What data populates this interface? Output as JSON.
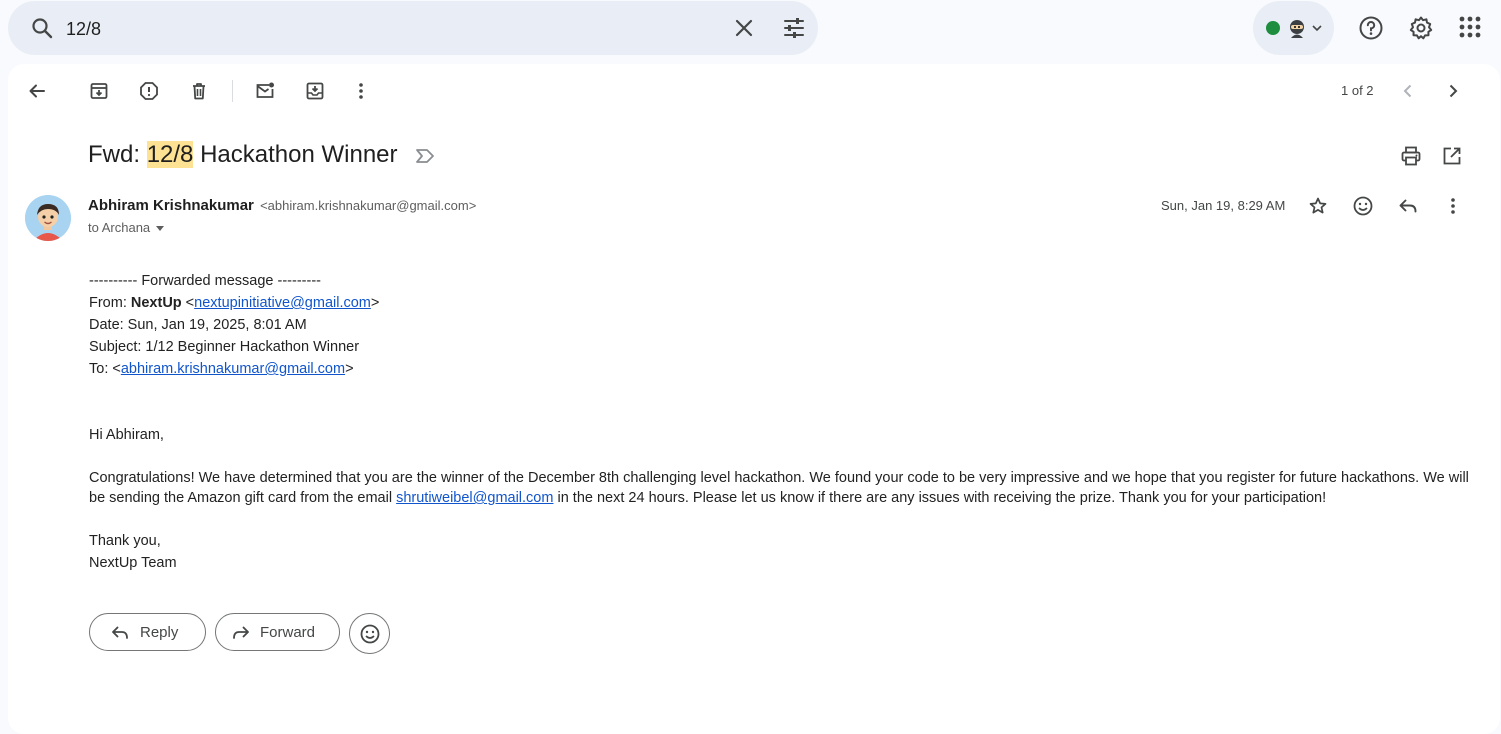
{
  "search": {
    "query": "12/8"
  },
  "toolbar": {
    "pager": "1 of 2"
  },
  "message": {
    "subject_prefix": "Fwd: ",
    "subject_highlight": "12/8",
    "subject_suffix": " Hackathon Winner",
    "sender_name": "Abhiram Krishnakumar",
    "sender_email": "<abhiram.krishnakumar@gmail.com>",
    "recipient": "to Archana",
    "date": "Sun, Jan 19, 8:29 AM"
  },
  "body": {
    "fwd_header": "---------- Forwarded message ---------",
    "from_label": "From: ",
    "from_name": "NextUp",
    "from_open": " <",
    "from_email": "nextupinitiative@gmail.com",
    "from_close": ">",
    "date_line": "Date: Sun, Jan 19, 2025, 8:01 AM",
    "subject_line": "Subject: 1/12 Beginner Hackathon Winner",
    "to_label": "To: <",
    "to_email": "abhiram.krishnakumar@gmail.com",
    "to_close": ">",
    "greeting": "Hi Abhiram,",
    "para_part1": "Congratulations! We have determined that you are the winner of the December 8th challenging level hackathon. We found your code to be very impressive and we hope that you register for future hackathons. We will be sending the Amazon gift card from the email ",
    "para_link": "shrutiweibel@gmail.com",
    "para_part2": " in the next 24 hours. Please let us know if there are any issues with receiving the prize. Thank you for your participation!",
    "signoff": "Thank you,",
    "signature": "NextUp Team"
  },
  "actions": {
    "reply": "Reply",
    "forward": "Forward"
  },
  "icons": {
    "search": "search-icon",
    "clear": "close-icon",
    "tune": "tune-icon",
    "status": "status-dot",
    "avatar_status": "ninja-icon",
    "help": "help-icon",
    "settings": "gear-icon",
    "apps": "apps-grid-icon",
    "back": "back-arrow-icon",
    "archive": "archive-icon",
    "spam": "report-spam-icon",
    "delete": "trash-icon",
    "unread": "mark-unread-icon",
    "move": "move-to-icon",
    "more": "more-vert-icon",
    "prev": "chevron-left-icon",
    "next": "chevron-right-icon",
    "label": "label-icon",
    "print": "print-icon",
    "open": "open-new-window-icon",
    "star": "star-icon",
    "emoji": "emoji-icon",
    "reply": "reply-icon",
    "forward": "forward-icon"
  },
  "colors": {
    "link": "#1155cc",
    "highlight": "#fde293",
    "status": "#1e8e3e",
    "search_bg": "#e9eef6"
  }
}
